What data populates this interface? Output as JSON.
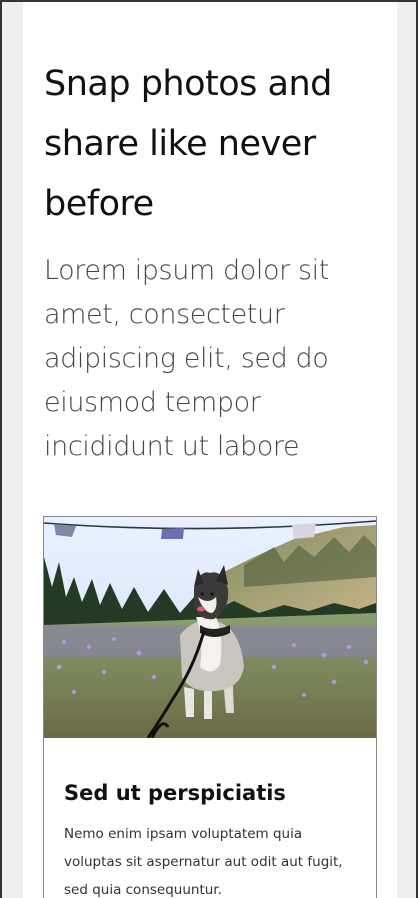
{
  "hero": {
    "title": "Snap photos and share like never before",
    "text": "Lorem ipsum dolor sit amet, consectetur adipiscing elit, sed do eiusmod tempor incididunt ut labore"
  },
  "card": {
    "image_icon": "husky-dog-photo",
    "title": "Sed ut perspiciatis",
    "text": "Nemo enim ipsam voluptatem quia voluptas sit aspernatur aut odit aut fugit, sed quia consequuntur."
  },
  "colors": {
    "page_background": "#ffffff",
    "outer_background": "#efefef",
    "heading": "#111111",
    "body_text": "#444444"
  }
}
